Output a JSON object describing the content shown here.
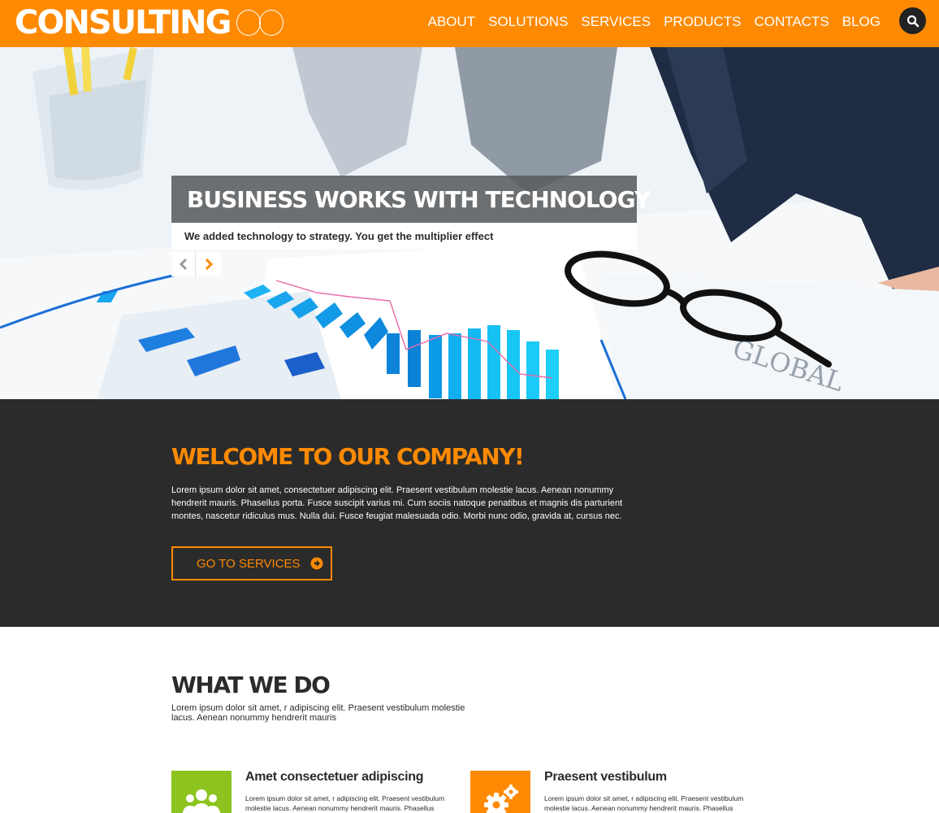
{
  "header": {
    "logo_text": "CONSULTING",
    "nav": [
      "ABOUT",
      "SOLUTIONS",
      "SERVICES",
      "PRODUCTS",
      "CONTACTS",
      "BLOG"
    ],
    "search_icon": "search-icon"
  },
  "hero": {
    "title": "BUSINESS WORKS WITH TECHNOLOGY",
    "subtitle": "We added technology to strategy. You get the multiplier effect"
  },
  "welcome": {
    "title": "WELCOME TO OUR COMPANY!",
    "text": "Lorem ipsum dolor sit amet, consectetuer adipiscing elit. Praesent vestibulum molestie lacus. Aenean nonummy hendrerit mauris. Phasellus porta. Fusce suscipit varius mi. Cum sociis natoque penatibus et magnis dis parturient montes, nascetur ridiculus mus. Nulla dui. Fusce feugiat malesuada odio. Morbi nunc odio, gravida at, cursus nec.",
    "button_label": "GO TO SERVICES"
  },
  "what_we_do": {
    "title": "WHAT WE DO",
    "text": "Lorem ipsum dolor sit amet, r adipiscing elit. Praesent vestibulum molestie lacus. Aenean nonummy hendrerit mauris",
    "features": [
      {
        "title": "Amet consectetuer adipiscing",
        "text": "Lorem ipsum dolor sit amet, r adipiscing elit. Praesent vestibulum molestie lacus. Aenean nonummy hendrerit mauris. Phasellus porta.",
        "icon": "users-icon",
        "color": "#8cc31e"
      },
      {
        "title": "Praesent vestibulum",
        "text": "Lorem ipsum dolor sit amet, r adipiscing elit. Praesent vestibulum molestie lacus. Aenean nonummy hendrerit mauris. Phasellus porta.",
        "icon": "gears-icon",
        "color": "#fe8a03"
      }
    ]
  },
  "colors": {
    "accent": "#fe8a03",
    "dark": "#2b2b2b",
    "green": "#8cc31e"
  }
}
